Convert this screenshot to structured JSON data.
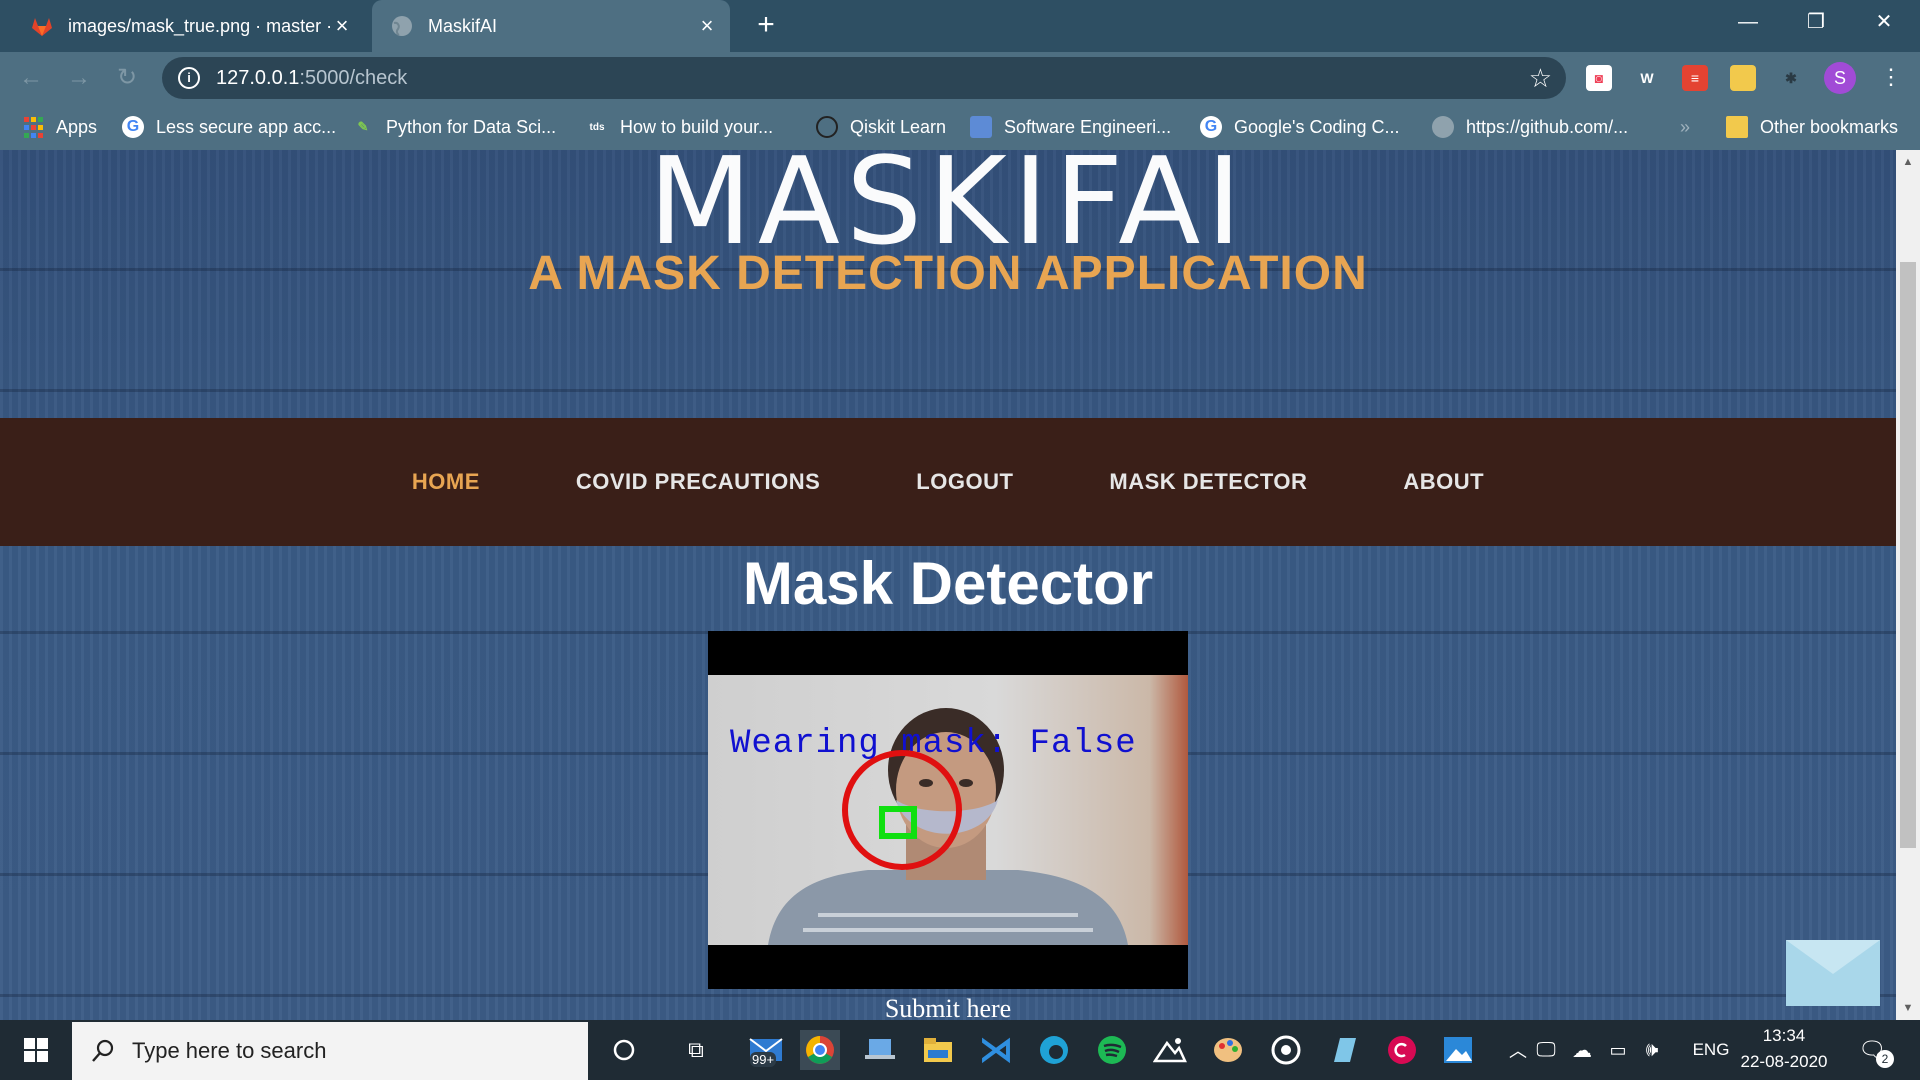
{
  "browser": {
    "tabs": [
      {
        "title": "images/mask_true.png · master ·",
        "active": false
      },
      {
        "title": "MaskifAI",
        "active": true
      }
    ],
    "url_host": "127.0.0.1",
    "url_path": ":5000/check",
    "profile_initial": "S",
    "bookmarks": [
      {
        "label": "Apps"
      },
      {
        "label": "Less secure app acc..."
      },
      {
        "label": "Python for Data Sci..."
      },
      {
        "label": "How to build your..."
      },
      {
        "label": "Qiskit Learn"
      },
      {
        "label": "Software Engineeri..."
      },
      {
        "label": "Google's Coding C..."
      },
      {
        "label": "https://github.com/..."
      },
      {
        "label": "Other bookmarks"
      }
    ],
    "bookmark_overflow": "»"
  },
  "page": {
    "brand": "MASKIFAI",
    "tagline": "A MASK DETECTION APPLICATION",
    "nav": [
      {
        "label": "HOME",
        "active": true
      },
      {
        "label": "COVID PRECAUTIONS",
        "active": false
      },
      {
        "label": "LOGOUT",
        "active": false
      },
      {
        "label": "MASK DETECTOR",
        "active": false
      },
      {
        "label": "ABOUT",
        "active": false
      }
    ],
    "section_title": "Mask Detector",
    "video_overlay_text": "Wearing mask: False",
    "submit_label": "Submit here"
  },
  "taskbar": {
    "search_placeholder": "Type here to search",
    "mail_badge": "99+",
    "language": "ENG",
    "time": "13:34",
    "date": "22-08-2020",
    "notification_count": "2"
  },
  "colors": {
    "accent_orange": "#e8a552",
    "navbar_bg": "#3a1f18",
    "page_blue": "#3b5a80",
    "overlay_text_blue": "#1010d0"
  }
}
